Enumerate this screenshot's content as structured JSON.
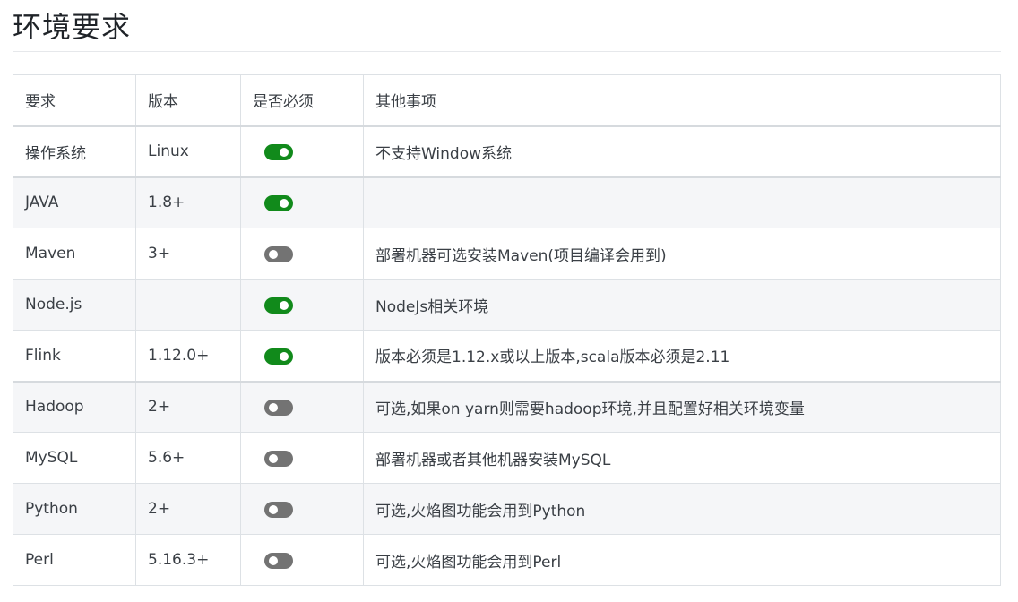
{
  "page": {
    "title": "环境要求"
  },
  "table": {
    "headers": [
      "要求",
      "版本",
      "是否必须",
      "其他事项"
    ],
    "rows": [
      {
        "requirement": "操作系统",
        "version": "Linux",
        "required": true,
        "notes": "不支持Window系统"
      },
      {
        "requirement": "JAVA",
        "version": "1.8+",
        "required": true,
        "notes": ""
      },
      {
        "requirement": "Maven",
        "version": "3+",
        "required": false,
        "notes": "部署机器可选安装Maven(项目编译会用到)"
      },
      {
        "requirement": "Node.js",
        "version": "",
        "required": true,
        "notes": "NodeJs相关环境"
      },
      {
        "requirement": "Flink",
        "version": "1.12.0+",
        "required": true,
        "notes": "版本必须是1.12.x或以上版本,scala版本必须是2.11"
      },
      {
        "requirement": "Hadoop",
        "version": "2+",
        "required": false,
        "notes": "可选,如果on yarn则需要hadoop环境,并且配置好相关环境变量"
      },
      {
        "requirement": "MySQL",
        "version": "5.6+",
        "required": false,
        "notes": "部署机器或者其他机器安装MySQL"
      },
      {
        "requirement": "Python",
        "version": "2+",
        "required": false,
        "notes": "可选,火焰图功能会用到Python"
      },
      {
        "requirement": "Perl",
        "version": "5.16.3+",
        "required": false,
        "notes": "可选,火焰图功能会用到Perl"
      }
    ]
  },
  "colors": {
    "toggle_on": "#118a1b",
    "toggle_off": "#737373",
    "zebra_row": "#f5f6f8"
  }
}
